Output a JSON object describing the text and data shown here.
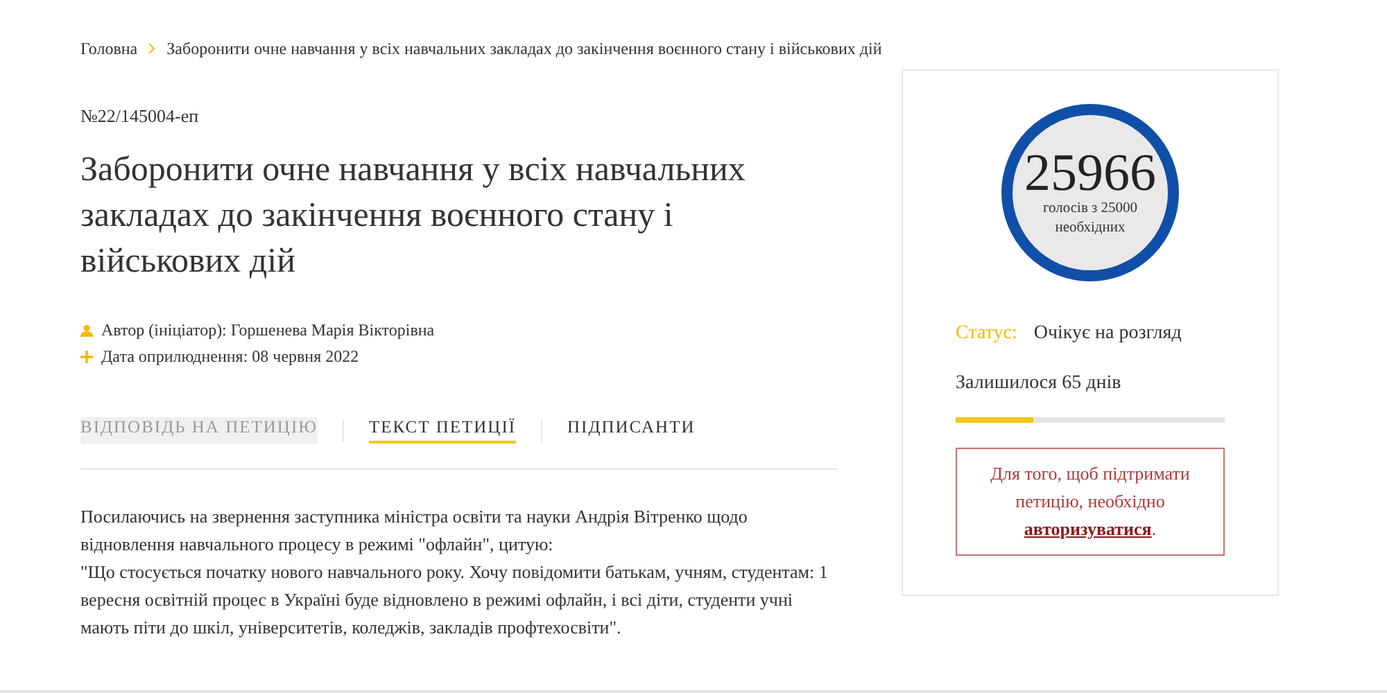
{
  "breadcrumb": {
    "items": [
      {
        "label": "Головна"
      },
      {
        "label": "Заборонити очне навчання у всіх навчальних закладах до закінчення воєнного стану і військових дій"
      }
    ]
  },
  "petition": {
    "number": "№22/145004-еп",
    "title": "Заборонити очне навчання у всіх навчальних закладах до закінчення воєнного стану і військових дій",
    "meta": [
      {
        "kind": "author",
        "text": "Автор (ініціатор): Горшенева Марія Вікторівна"
      },
      {
        "kind": "date",
        "text": "Дата оприлюднення: 08 червня 2022"
      }
    ]
  },
  "tabs": [
    {
      "label": "ВІДПОВІДЬ НА ПЕТИЦІЮ",
      "selected": false,
      "disabled": true
    },
    {
      "label": "ТЕКСТ ПЕТИЦІЇ",
      "selected": true,
      "disabled": false
    },
    {
      "label": "ПІДПИСАНТИ",
      "selected": false,
      "disabled": false
    }
  ],
  "body": [
    "Посилаючись на звернення заступника міністра освіти та науки Андрія Вітренко щодо відновлення навчального процесу в режимі \"офлайн\", цитую:",
    "\"Що стосується початку нового навчального року. Хочу повідомити батькам, учням, студентам: 1 вересня освітній процес в Україні буде відновлено в режимі офлайн, і всі діти, студенти учні мають піти до шкіл, університетів, коледжів, закладів профтехосвіти\"."
  ],
  "votes": {
    "count": "25966",
    "caption": "голосів з 25000 необхідних"
  },
  "status": {
    "label": "Статус:",
    "value": "Очікує на розгляд"
  },
  "remaining": {
    "text": "Залишилося 65 днів",
    "level": 0.29
  },
  "auth_notice": {
    "text": "Для того, щоб підтримати петицію, необхідно",
    "link": "авторизуватися",
    "suffix": "."
  }
}
